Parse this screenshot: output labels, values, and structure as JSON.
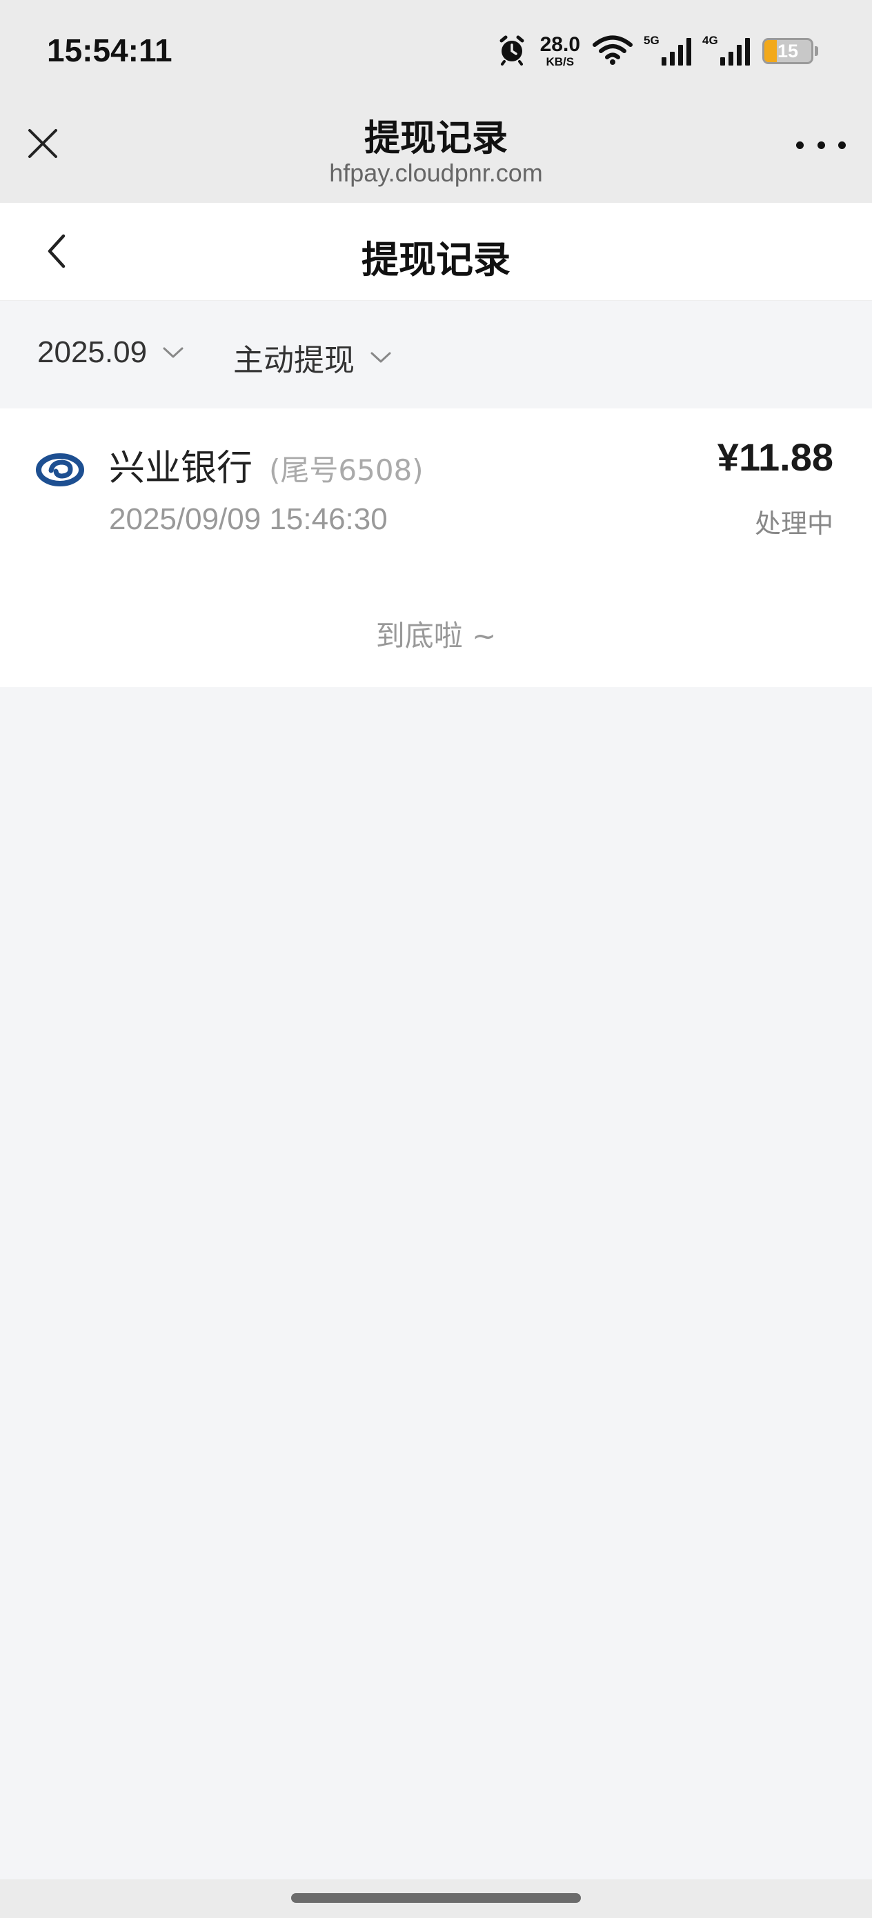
{
  "status_bar": {
    "time": "15:54:11",
    "alarm_icon": "alarm-clock-icon",
    "net_speed_value": "28.0",
    "net_speed_unit": "KB/S",
    "wifi_icon": "wifi-icon",
    "signal_1_label": "5G",
    "signal_2_label": "4G",
    "battery_level": "15",
    "battery_fraction": 0.15
  },
  "browser": {
    "title": "提现记录",
    "url": "hfpay.cloudpnr.com",
    "close_icon": "close-icon",
    "more_icon": "more-dots-icon"
  },
  "nav": {
    "title": "提现记录",
    "back_icon": "chevron-left-icon"
  },
  "filters": {
    "date": "2025.09",
    "type": "主动提现",
    "dropdown_icon": "chevron-down-icon"
  },
  "records": [
    {
      "bank": "兴业银行",
      "card_tail": "(尾号6508)",
      "time": "2025/09/09 15:46:30",
      "amount": "¥11.88",
      "status": "处理中",
      "logo_icon": "cib-bank-logo-icon"
    }
  ],
  "end_tip": "到底啦 ~",
  "colors": {
    "header_bg": "#ebebeb",
    "page_bg": "#f4f5f7",
    "card_bg": "#ffffff",
    "bank_logo": "#1d4f91",
    "battery_fill": "#f2a91b"
  }
}
